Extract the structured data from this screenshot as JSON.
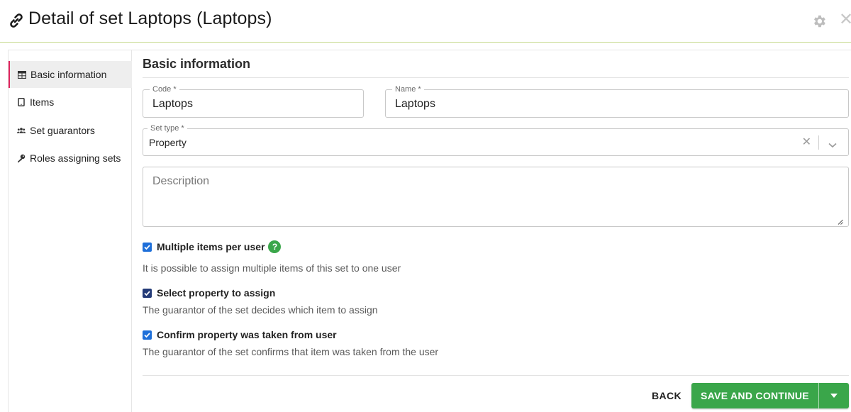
{
  "header": {
    "title": "Detail of set Laptops (Laptops)",
    "title_icon": "link-icon",
    "settings_icon": "gear-icon",
    "close_icon": "close-icon",
    "close_glyph": "✕"
  },
  "sidebar": {
    "items": [
      {
        "label": "Basic information",
        "icon": "table-icon",
        "active": true
      },
      {
        "label": "Items",
        "icon": "tablet-icon",
        "active": false
      },
      {
        "label": "Set guarantors",
        "icon": "users-icon",
        "active": false
      },
      {
        "label": "Roles assigning sets",
        "icon": "key-icon",
        "active": false
      }
    ]
  },
  "main": {
    "section_title": "Basic information",
    "code": {
      "label": "Code *",
      "value": "Laptops"
    },
    "name": {
      "label": "Name *",
      "value": "Laptops"
    },
    "set_type": {
      "label": "Set type *",
      "value": "Property",
      "clear_glyph": "✕"
    },
    "description": {
      "placeholder": "Description",
      "value": ""
    },
    "options": [
      {
        "label": "Multiple items per user",
        "description": "It is possible to assign multiple items of this set to one user",
        "checked": true,
        "help": "?"
      },
      {
        "label": "Select property to assign",
        "description": "The guarantor of the set decides which item to assign",
        "checked": true
      },
      {
        "label": "Confirm property was taken from user",
        "description": "The guarantor of the set confirms that item was taken from the user",
        "checked": true
      }
    ]
  },
  "footer": {
    "back_label": "BACK",
    "save_label": "SAVE AND CONTINUE"
  },
  "colors": {
    "accent_green": "#3aa64a",
    "active_nav_border": "#e0245e",
    "checkbox_blue": "#1e6fd9",
    "header_rule": "#c5d98a"
  }
}
